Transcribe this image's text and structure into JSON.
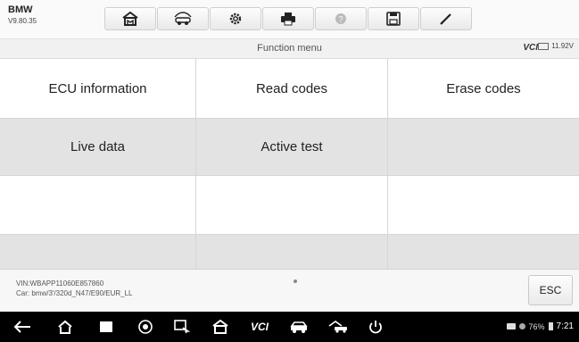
{
  "header": {
    "brand": "BMW",
    "version": "V9.80.35",
    "tools": [
      {
        "name": "home-icon"
      },
      {
        "name": "vehicle-swap-icon"
      },
      {
        "name": "settings-gear-icon"
      },
      {
        "name": "print-icon"
      },
      {
        "name": "help-icon"
      },
      {
        "name": "save-icon"
      },
      {
        "name": "pen-icon"
      }
    ]
  },
  "status_strip": {
    "title": "Function menu",
    "vci_label": "VCI",
    "battery_voltage": "11.92V"
  },
  "functions": [
    [
      "ECU information",
      "Read codes",
      "Erase codes"
    ],
    [
      "Live data",
      "Active test",
      ""
    ],
    [
      "",
      "",
      ""
    ],
    [
      "",
      "",
      ""
    ]
  ],
  "vehicle": {
    "vin": "VIN:WBAPP11060E857860",
    "car": "Car: bmw/3'/320d_N47/E90/EUR_LL"
  },
  "footer": {
    "esc_label": "ESC"
  },
  "android_nav": {
    "items": [
      "back-icon",
      "home-icon",
      "recents-icon",
      "chrome-icon",
      "remote-desktop-icon",
      "maxisys-home-icon",
      "vci-icon",
      "vehicle-icon",
      "shop-icon",
      "power-icon"
    ],
    "vci_text": "VCI",
    "battery_percent": "76%",
    "time": "7:21"
  },
  "colors": {
    "toolbar_bg": "#fafafa",
    "grid_alt_row": "#e3e3e3",
    "nav_bar": "#000000"
  }
}
